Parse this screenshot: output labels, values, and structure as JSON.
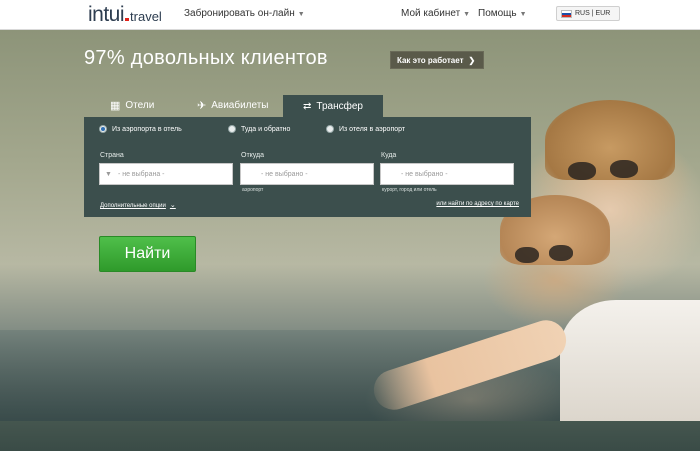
{
  "header": {
    "logo_main": "intui",
    "logo_sub": "travel",
    "nav": {
      "book_online": "Забронировать он-лайн",
      "my_account": "Мой кабинет",
      "help": "Помощь"
    },
    "lang_currency": "RUS | EUR"
  },
  "hero": {
    "title": "97% довольных клиентов",
    "how_it_works": "Как это работает"
  },
  "tabs": [
    {
      "label": "Отели",
      "icon": "hotel-icon",
      "active": false
    },
    {
      "label": "Авиабилеты",
      "icon": "plane-icon",
      "active": false
    },
    {
      "label": "Трансфер",
      "icon": "transfer-icon",
      "active": true
    }
  ],
  "form": {
    "radios": [
      {
        "label": "Из аэропорта в отель",
        "selected": true
      },
      {
        "label": "Туда и обратно",
        "selected": false
      },
      {
        "label": "Из отеля в аэропорт",
        "selected": false
      }
    ],
    "fields": [
      {
        "label": "Страна",
        "placeholder": "- не выбрана -",
        "hint": ""
      },
      {
        "label": "Откуда",
        "placeholder": "- не выбрано -",
        "hint": "аэропорт"
      },
      {
        "label": "Куда",
        "placeholder": "- не выбрано -",
        "hint": "курорт, город или отель"
      }
    ],
    "extra_options": "Дополнительные опции",
    "map_link": "или найти по адресу по карте",
    "submit": "Найти"
  },
  "colors": {
    "panel": "#3c4f4d",
    "submit_green": "#3aaa35",
    "header_bg": "#ffffff"
  }
}
